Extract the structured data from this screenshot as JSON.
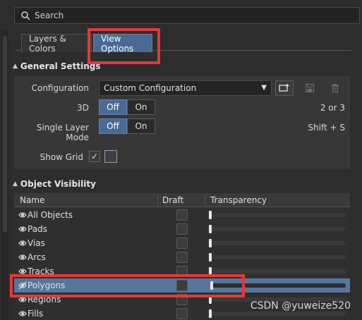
{
  "search": {
    "placeholder": "Search"
  },
  "tabs": [
    {
      "label": "Layers & Colors",
      "active": false
    },
    {
      "label": "View Options",
      "active": true
    }
  ],
  "general_settings": {
    "title": "General Settings",
    "configuration": {
      "label": "Configuration",
      "value": "Custom Configuration"
    },
    "three_d": {
      "label": "3D",
      "off": "Off",
      "on": "On",
      "selected": "Off",
      "shortcut": "2 or 3"
    },
    "single_layer": {
      "label": "Single Layer Mode",
      "off": "Off",
      "on": "On",
      "selected": "Off",
      "shortcut": "Shift + S"
    },
    "show_grid": {
      "label": "Show Grid",
      "checked": true
    }
  },
  "object_visibility": {
    "title": "Object Visibility",
    "columns": [
      "Name",
      "Draft",
      "Transparency"
    ],
    "rows": [
      {
        "name": "All Objects",
        "visible": true,
        "selected": false,
        "transparency": 0
      },
      {
        "name": "Pads",
        "visible": true,
        "selected": false,
        "transparency": 0
      },
      {
        "name": "Vias",
        "visible": true,
        "selected": false,
        "transparency": 0
      },
      {
        "name": "Arcs",
        "visible": true,
        "selected": false,
        "transparency": 0
      },
      {
        "name": "Tracks",
        "visible": true,
        "selected": false,
        "transparency": 0
      },
      {
        "name": "Polygons",
        "visible": false,
        "selected": true,
        "transparency": 0
      },
      {
        "name": "Regions",
        "visible": true,
        "selected": false,
        "transparency": 0
      },
      {
        "name": "Fills",
        "visible": true,
        "selected": false,
        "transparency": 0
      }
    ]
  },
  "watermark": "CSDN @yuweize520",
  "colors": {
    "accent": "#4a6a94",
    "selected_row": "#54779f",
    "highlight": "#e53935"
  }
}
